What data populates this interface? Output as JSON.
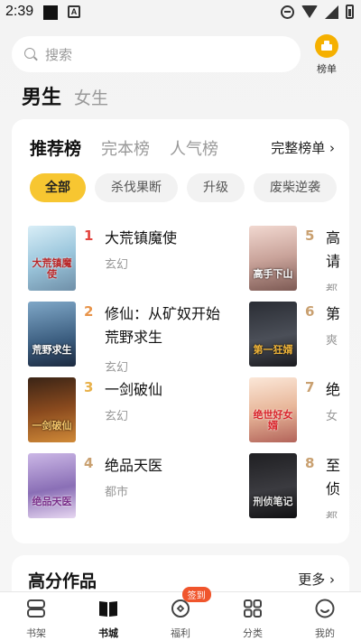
{
  "status": {
    "time": "2:39"
  },
  "search": {
    "placeholder": "搜索"
  },
  "rank_button": {
    "label": "榜单"
  },
  "gender": {
    "active": "男生",
    "other": "女生"
  },
  "rank_tabs": {
    "tabs": [
      "推荐榜",
      "完本榜",
      "人气榜"
    ],
    "full": "完整榜单 ›"
  },
  "chips": [
    "全部",
    "杀伐果断",
    "升级",
    "废柴逆袭"
  ],
  "books_left": [
    {
      "rank": "1",
      "title": "大荒镇魔使",
      "category": "玄幻",
      "cover_text": "大荒镇魔使"
    },
    {
      "rank": "2",
      "title": "修仙：从矿奴开始",
      "title2": "荒野求生",
      "category": "玄幻",
      "cover_text": "荒野求生"
    },
    {
      "rank": "3",
      "title": "一剑破仙",
      "category": "玄幻",
      "cover_text": "一剑破仙"
    },
    {
      "rank": "4",
      "title": "绝品天医",
      "category": "都市",
      "cover_text": "绝品天医"
    }
  ],
  "books_right": [
    {
      "rank": "5",
      "title": "高",
      "title2": "请",
      "category": "都",
      "cover_text": "高手下山"
    },
    {
      "rank": "6",
      "title": "第",
      "category": "爽",
      "cover_text": "第一狂婿"
    },
    {
      "rank": "7",
      "title": "绝",
      "category": "女",
      "cover_text": "绝世好女婿"
    },
    {
      "rank": "8",
      "title": "至",
      "title2": "侦",
      "category": "都",
      "cover_text": "刑侦笔记"
    }
  ],
  "high_score": {
    "title": "高分作品",
    "more": "更多 ›"
  },
  "nav": [
    {
      "label": "书架",
      "icon": "bookshelf-icon"
    },
    {
      "label": "书城",
      "icon": "book-icon"
    },
    {
      "label": "福利",
      "icon": "gift-icon",
      "badge": "签到"
    },
    {
      "label": "分类",
      "icon": "grid-icon"
    },
    {
      "label": "我的",
      "icon": "smile-icon"
    }
  ],
  "colors": {
    "accent": "#f7c631",
    "rank_red": "#e3453f",
    "rank_orange": "#e8944a",
    "rank_yellow": "#e8b14a",
    "rank_gray": "#c9a070",
    "badge": "#f0552c"
  }
}
